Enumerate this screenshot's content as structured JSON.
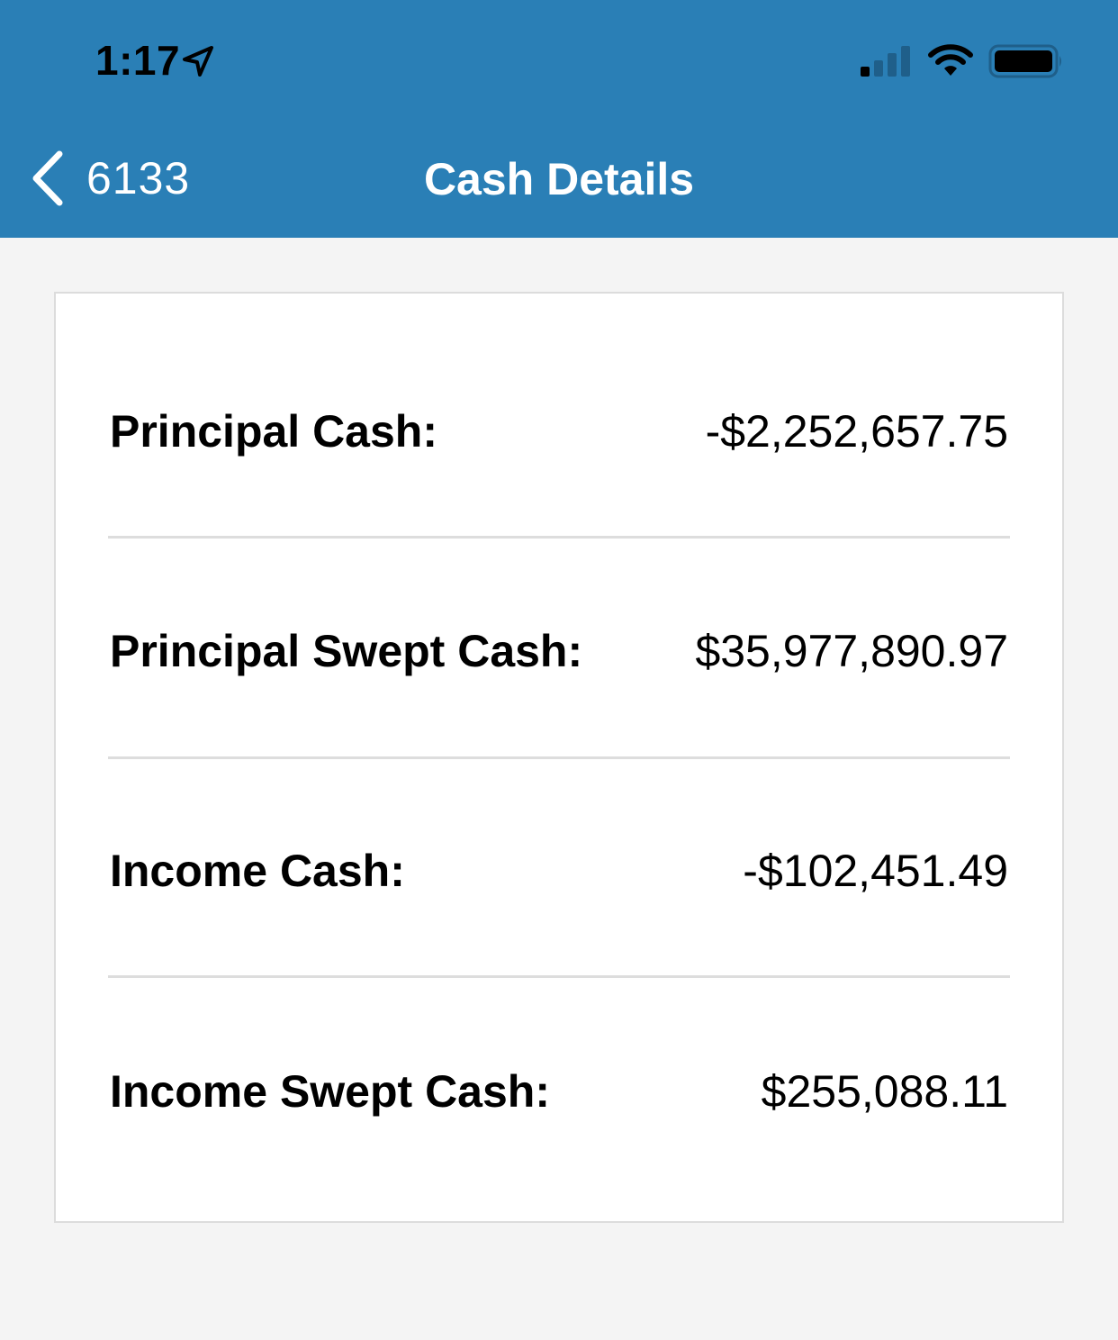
{
  "status_bar": {
    "time": "1:17",
    "icons": [
      "location-arrow-icon",
      "cellular-signal-icon",
      "wifi-icon",
      "battery-icon"
    ]
  },
  "nav": {
    "back_label": "6133",
    "title": "Cash Details",
    "background_color": "#2a7fb6"
  },
  "cash_details": [
    {
      "label": "Principal Cash:",
      "value": "-$2,252,657.75"
    },
    {
      "label": "Principal Swept Cash:",
      "value": "$35,977,890.97"
    },
    {
      "label": "Income Cash:",
      "value": "-$102,451.49"
    },
    {
      "label": "Income Swept Cash:",
      "value": "$255,088.11"
    }
  ]
}
